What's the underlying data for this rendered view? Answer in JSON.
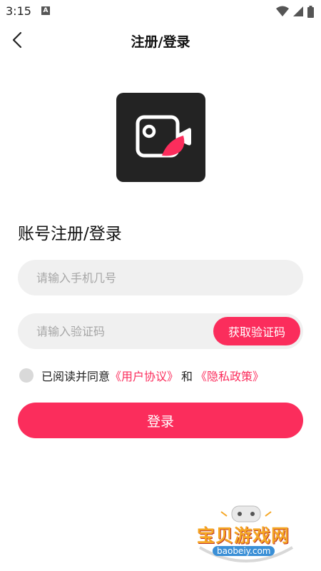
{
  "status_bar": {
    "time": "3:15",
    "notification_letter": "A"
  },
  "nav": {
    "title": "注册/登录"
  },
  "form": {
    "section_title": "账号注册/登录",
    "phone_placeholder": "请输入手机几号",
    "code_placeholder": "请输入验证码",
    "get_code_label": "获取验证码",
    "agreement_prefix": "已阅读并同意",
    "user_agreement": "《用户协议》",
    "and": "和",
    "privacy_policy": "《隐私政策》",
    "login_label": "登录"
  },
  "watermark": {
    "name": "宝贝游戏网",
    "domain": "baobeiy.com"
  },
  "colors": {
    "accent": "#fb2d5c",
    "logo_bg": "#232323",
    "field_bg": "#f0f0f0"
  },
  "icons": {
    "back": "chevron-left-icon",
    "logo": "camera-app-icon"
  }
}
